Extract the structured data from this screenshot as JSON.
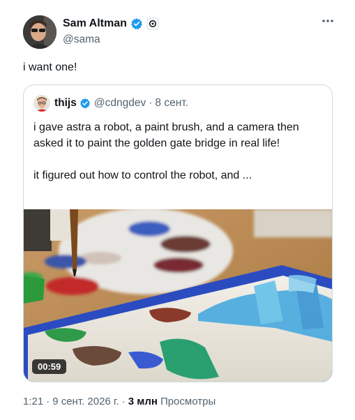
{
  "author": {
    "display_name": "Sam Altman",
    "handle": "@sama",
    "verified_icon": "verified-badge-icon",
    "affiliate_icon": "openai-affiliate-icon"
  },
  "tweet": {
    "text": "i want one!"
  },
  "quoted": {
    "display_name": "thijs",
    "handle": "@cdngdev",
    "separator": "·",
    "date": "8 сент.",
    "paragraphs": [
      "i gave astra a robot, a paint brush, and a camera then asked it to paint the golden gate bridge in real life!",
      "it figured out how to control the robot, and ..."
    ],
    "video_duration": "00:59"
  },
  "meta": {
    "time": "1:21",
    "sep1": "·",
    "date": "9 сент. 2026 г.",
    "sep2": "·",
    "views_count": "3 млн",
    "views_label": "Просмотры"
  },
  "colors": {
    "text": "#0f1419",
    "secondary": "#536471",
    "verified_blue": "#1d9bf0",
    "border": "#cfd9de"
  }
}
